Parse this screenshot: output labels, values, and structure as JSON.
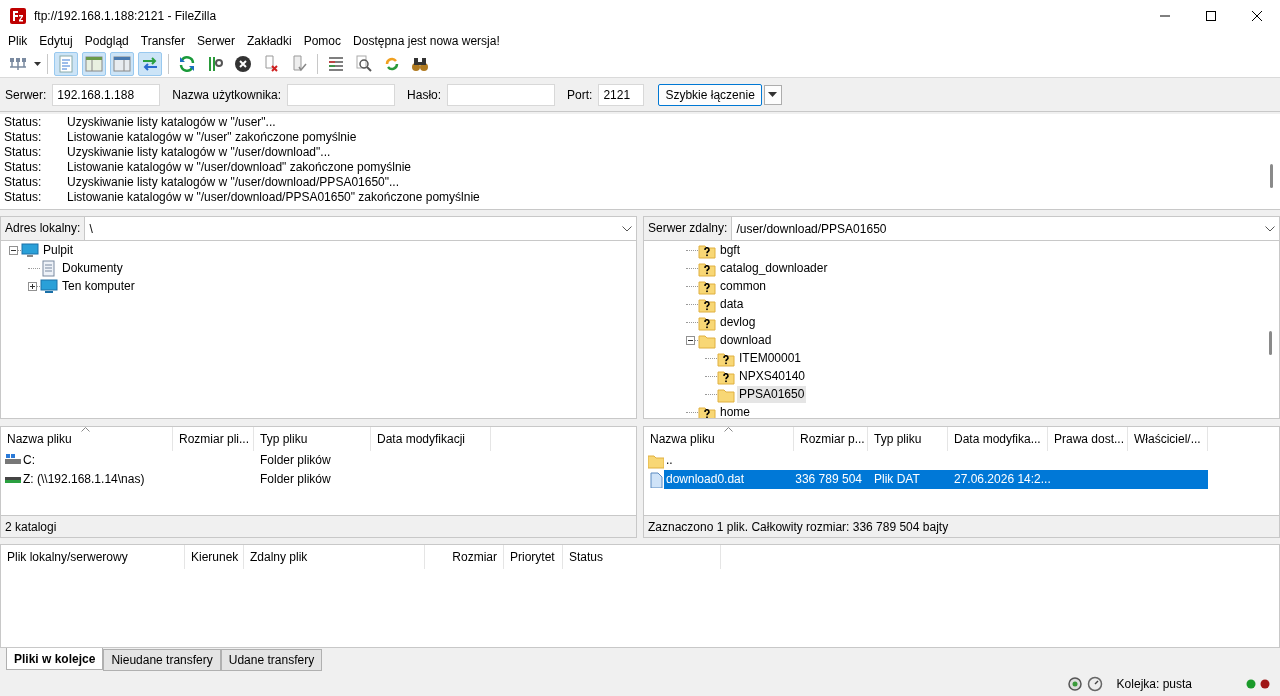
{
  "window": {
    "title": "ftp://192.168.1.188:2121 - FileZilla"
  },
  "menu": [
    "Plik",
    "Edytuj",
    "Podgląd",
    "Transfer",
    "Serwer",
    "Zakładki",
    "Pomoc",
    "Dostępna jest nowa wersja!"
  ],
  "view_toggles": [
    {
      "on": true
    },
    {
      "on": true
    },
    {
      "on": true
    },
    {
      "on": true
    }
  ],
  "quickconnect": {
    "fields": [
      {
        "label": "Serwer:",
        "value": "192.168.1.188"
      },
      {
        "label": "Nazwa użytkownika:"
      },
      {
        "label": "Hasło:"
      },
      {
        "label": "Port:",
        "value": "2121"
      }
    ],
    "button": "Szybkie łączenie"
  },
  "log": [
    {
      "label": "Status:",
      "message": "Uzyskiwanie listy katalogów w \"/user\"..."
    },
    {
      "label": "Status:",
      "message": "Listowanie katalogów w \"/user\" zakończone pomyślnie"
    },
    {
      "label": "Status:",
      "message": "Uzyskiwanie listy katalogów w \"/user/download\"..."
    },
    {
      "label": "Status:",
      "message": "Listowanie katalogów w \"/user/download\" zakończone pomyślnie"
    },
    {
      "label": "Status:",
      "message": "Uzyskiwanie listy katalogów w \"/user/download/PPSA01650\"..."
    },
    {
      "label": "Status:",
      "message": "Listowanie katalogów w \"/user/download/PPSA01650\" zakończone pomyślnie"
    }
  ],
  "local": {
    "address_label": "Adres lokalny:",
    "address": "\\",
    "tree": [
      {
        "label": "Pulpit",
        "kind": "desktop",
        "expanded": true,
        "selected": false,
        "children": [
          {
            "label": "Dokumenty",
            "kind": "documents",
            "selected": false
          },
          {
            "label": "Ten komputer",
            "kind": "computer",
            "expanded": false,
            "selected": false
          }
        ]
      }
    ],
    "columns": [
      "Nazwa pliku",
      "Rozmiar pli...",
      "Typ pliku",
      "Data modyfikacji"
    ],
    "rows": [
      {
        "kind": "drive",
        "cells": [
          "C:",
          null,
          "Folder plików",
          null
        ],
        "selected": false
      },
      {
        "kind": "network_drive",
        "cells": [
          "Z: (\\\\192.168.1.14\\nas)",
          null,
          "Folder plików",
          null
        ],
        "selected": false
      }
    ],
    "status": "2 katalogi"
  },
  "remote": {
    "address_label": "Serwer zdalny:",
    "address": "/user/download/PPSA01650",
    "tree": [
      {
        "label": "bgft",
        "kind": "unknown",
        "selected": false
      },
      {
        "label": "catalog_downloader",
        "kind": "unknown",
        "selected": false
      },
      {
        "label": "common",
        "kind": "unknown",
        "selected": false
      },
      {
        "label": "data",
        "kind": "unknown",
        "selected": false
      },
      {
        "label": "devlog",
        "kind": "unknown",
        "selected": false
      },
      {
        "label": "download",
        "kind": "folder",
        "expanded": true,
        "selected": false,
        "children": [
          {
            "label": "ITEM00001",
            "kind": "unknown",
            "selected": false
          },
          {
            "label": "NPXS40140",
            "kind": "unknown",
            "selected": false
          },
          {
            "label": "PPSA01650",
            "kind": "folder",
            "selected": true
          }
        ]
      },
      {
        "label": "home",
        "kind": "unknown",
        "selected": false
      }
    ],
    "columns": [
      "Nazwa pliku",
      "Rozmiar p...",
      "Typ pliku",
      "Data modyfika...",
      "Prawa dost...",
      "Właściciel/..."
    ],
    "rows": [
      {
        "kind": "folder",
        "cells": [
          "..",
          null,
          null,
          null,
          null,
          null
        ],
        "selected": false
      },
      {
        "kind": "file",
        "cells": [
          "download0.dat",
          "336 789 504",
          "Plik DAT",
          "27.06.2026 14:2...",
          null,
          null
        ],
        "selected": true
      }
    ],
    "status": "Zaznaczono 1 plik. Całkowity rozmiar: 336 789 504 bajty"
  },
  "queue": {
    "columns": [
      "Plik lokalny/serwerowy",
      "Kierunek",
      "Zdalny plik",
      "Rozmiar",
      "Priorytet",
      "Status"
    ]
  },
  "tabs": [
    {
      "label": "Pliki w kolejce",
      "selected": true
    },
    {
      "label": "Nieudane transfery",
      "selected": false
    },
    {
      "label": "Udane transfery",
      "selected": false
    }
  ],
  "status_bar": {
    "queue": "Kolejka: pusta"
  }
}
